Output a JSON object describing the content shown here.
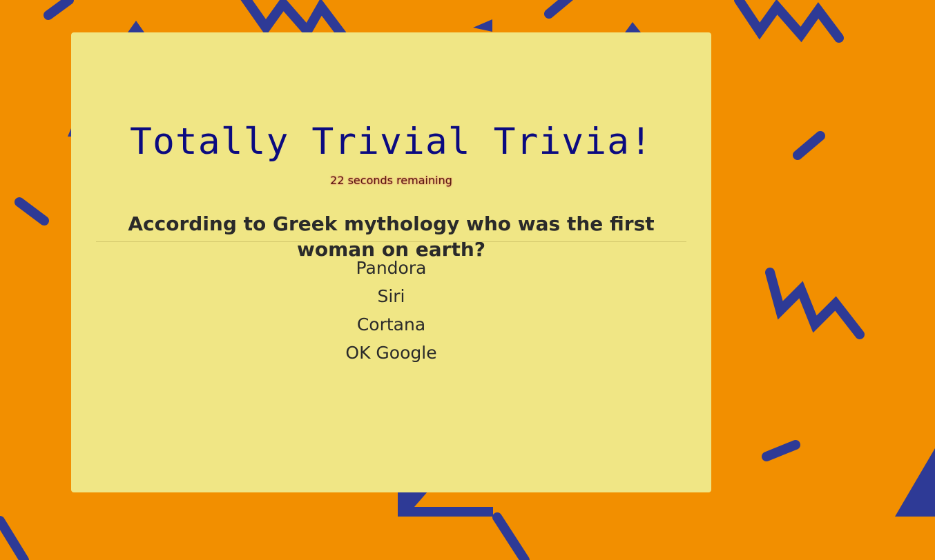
{
  "page": {
    "title": "Totally Trivial Trivia!",
    "timer_text": "22 seconds remaining"
  },
  "question": {
    "text": "According to Greek mythology who was the first woman on earth?"
  },
  "answers": [
    {
      "label": "Pandora"
    },
    {
      "label": "Siri"
    },
    {
      "label": "Cortana"
    },
    {
      "label": "OK Google"
    }
  ],
  "colors": {
    "background": "#f28f00",
    "pattern": "#2e3a96",
    "card": "#f0e685",
    "title": "#0b0b80",
    "text": "#2a2a2a"
  }
}
